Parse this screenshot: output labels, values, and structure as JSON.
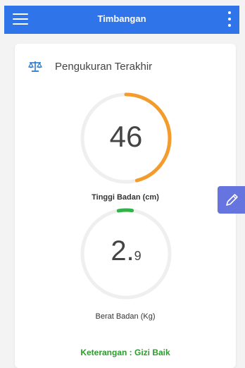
{
  "appbar": {
    "title": "Timbangan",
    "menu_icon": "hamburger-menu-icon",
    "more_icon": "more-vertical-icon",
    "color": "#2f74e8"
  },
  "card": {
    "header_icon": "scale-balance-icon",
    "header_title": "Pengukuran Terakhir"
  },
  "height_gauge": {
    "value": "46",
    "label": "Tinggi Badan (cm)",
    "progress": 0.46,
    "color": "#f39c2b"
  },
  "weight_gauge": {
    "value_int": "2.",
    "value_dec": "9",
    "label": "Berat Badan (Kg)",
    "progress": 0.05,
    "color": "#33b249"
  },
  "edit_button": {
    "icon": "pencil-icon",
    "color": "#6674e0"
  },
  "status": {
    "text": "Keterangan : Gizi Baik",
    "color": "#2e9b2e"
  }
}
